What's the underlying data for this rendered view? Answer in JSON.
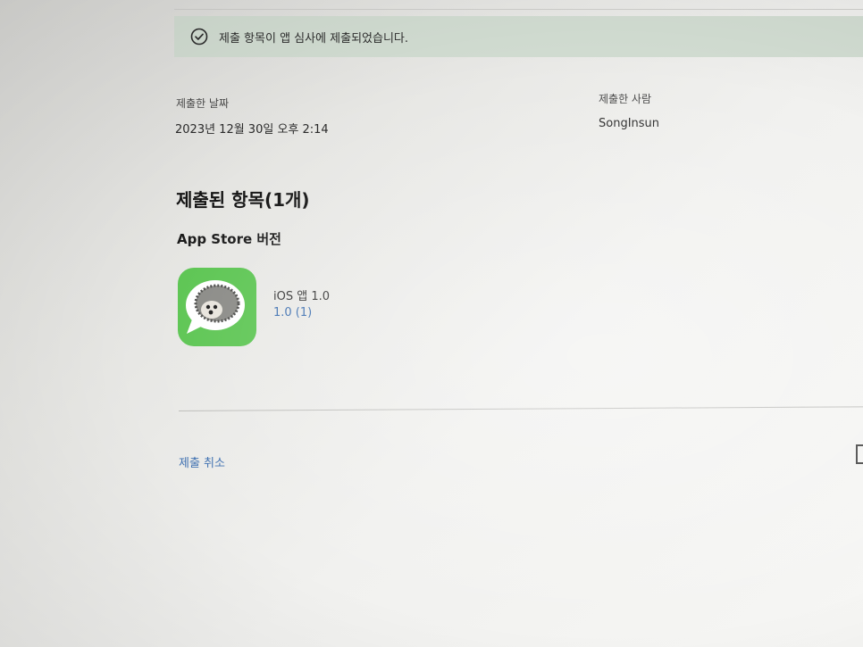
{
  "banner": {
    "icon": "check-circle-icon",
    "message": "제출 항목이 앱 심사에 제출되었습니다."
  },
  "submission": {
    "date_label": "제출한 날짜",
    "date_value": "2023년 12월 30일 오후 2:14",
    "submitter_label": "제출한 사람",
    "submitter_value": "SongInsun"
  },
  "items": {
    "title": "제출된 항목(1개)",
    "subtitle": "App Store 버전",
    "app": {
      "icon": "app-icon-green-chat-bubble-hedgehog",
      "name": "iOS 앱 1.0",
      "version": "1.0 (1)"
    }
  },
  "actions": {
    "cancel_label": "제출 취소"
  },
  "colors": {
    "banner_bg": "#d2ddd2",
    "link": "#3d6fb0",
    "app_icon_green": "#5cc552"
  }
}
